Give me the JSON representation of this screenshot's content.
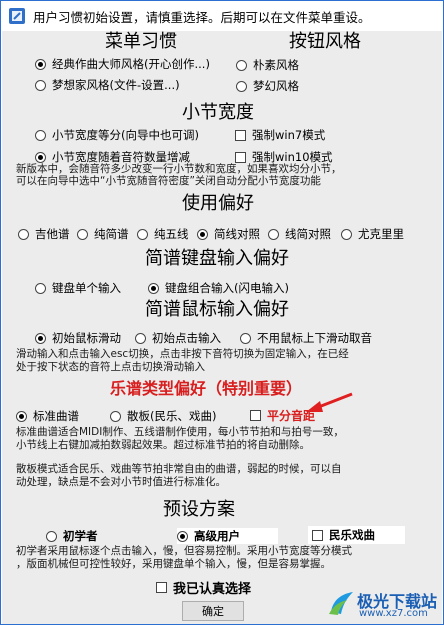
{
  "window": {
    "title": "用户习惯初始设置，请慎重选择。后期可以在文件菜单重设。"
  },
  "sections": {
    "menu_habit": {
      "heading": "菜单习惯",
      "options": [
        "经典作曲大师风格(开心创作...)",
        "梦想家风格(文件-设置...)"
      ],
      "selected": 0
    },
    "button_style": {
      "heading": "按钮风格",
      "options": [
        "朴素风格",
        "梦幻风格"
      ],
      "selected": -1
    },
    "measure_width": {
      "heading": "小节宽度",
      "options": [
        "小节宽度等分(向导中也可调)",
        "小节宽度随着音符数量增减"
      ],
      "selected": 1,
      "checks": [
        "强制win7模式",
        "强制win10模式"
      ],
      "note": [
        "新版本中，会随音符多少改变一行小节数和宽度，如果喜欢均分小节，",
        "可以在向导中选中“小节宽随音符密度”关闭自动分配小节宽度功能"
      ]
    },
    "usage": {
      "heading": "使用偏好",
      "options": [
        "吉他谱",
        "纯简谱",
        "纯五线",
        "简线对照",
        "线简对照",
        "尤克里里"
      ],
      "selected": 3
    },
    "keyboard_input": {
      "heading": "简谱键盘输入偏好",
      "options": [
        "键盘单个输入",
        "键盘组合输入(闪电输入)"
      ],
      "selected": 1
    },
    "mouse_input": {
      "heading": "简谱鼠标输入偏好",
      "options": [
        "初始鼠标滑动",
        "初始点击输入",
        "不用鼠标上下滑动取音"
      ],
      "selected": 0,
      "note": [
        "滑动输入和点击输入esc切换，点击非按下音符切换为固定输入，在已经",
        "处于按下状态的音符上点击切换滑动输入"
      ]
    },
    "score_type": {
      "heading": "乐谱类型偏好（特别重要）",
      "options": [
        "标准曲谱",
        "散板(民乐、戏曲)"
      ],
      "selected": 0,
      "check": "平分音距",
      "note1": [
        "标准曲谱适合MIDI制作、五线谱制作使用，每小节节拍和与拍号一致，",
        "小节线上右键加减拍数弱起效果。超过标准节拍的将自动删除。"
      ],
      "note2": [
        "散板模式适合民乐、戏曲等节拍非常自由的曲谱，弱起的时候，可以自",
        "动处理，缺点是不会对小节时值进行标准化。"
      ]
    },
    "preset": {
      "heading": "预设方案",
      "options": [
        "初学者",
        "高级用户",
        "民乐戏曲"
      ],
      "selected": 1,
      "note": [
        "初学者采用鼠标逐个点击输入，慢，但容易控制。采用小节宽度等分模式",
        "，版面机械但可控性较好，采用键盘单个输入，慢，但是容易掌握。"
      ]
    }
  },
  "confirm_check": "我已认真选择",
  "ok_button": "确定",
  "watermark": {
    "text": "极光下载站",
    "url": "www.xz7.com"
  },
  "colors": {
    "accent_red": "#d81e1e",
    "window_border": "#2b6fd1",
    "client_bg": "#ececec"
  }
}
